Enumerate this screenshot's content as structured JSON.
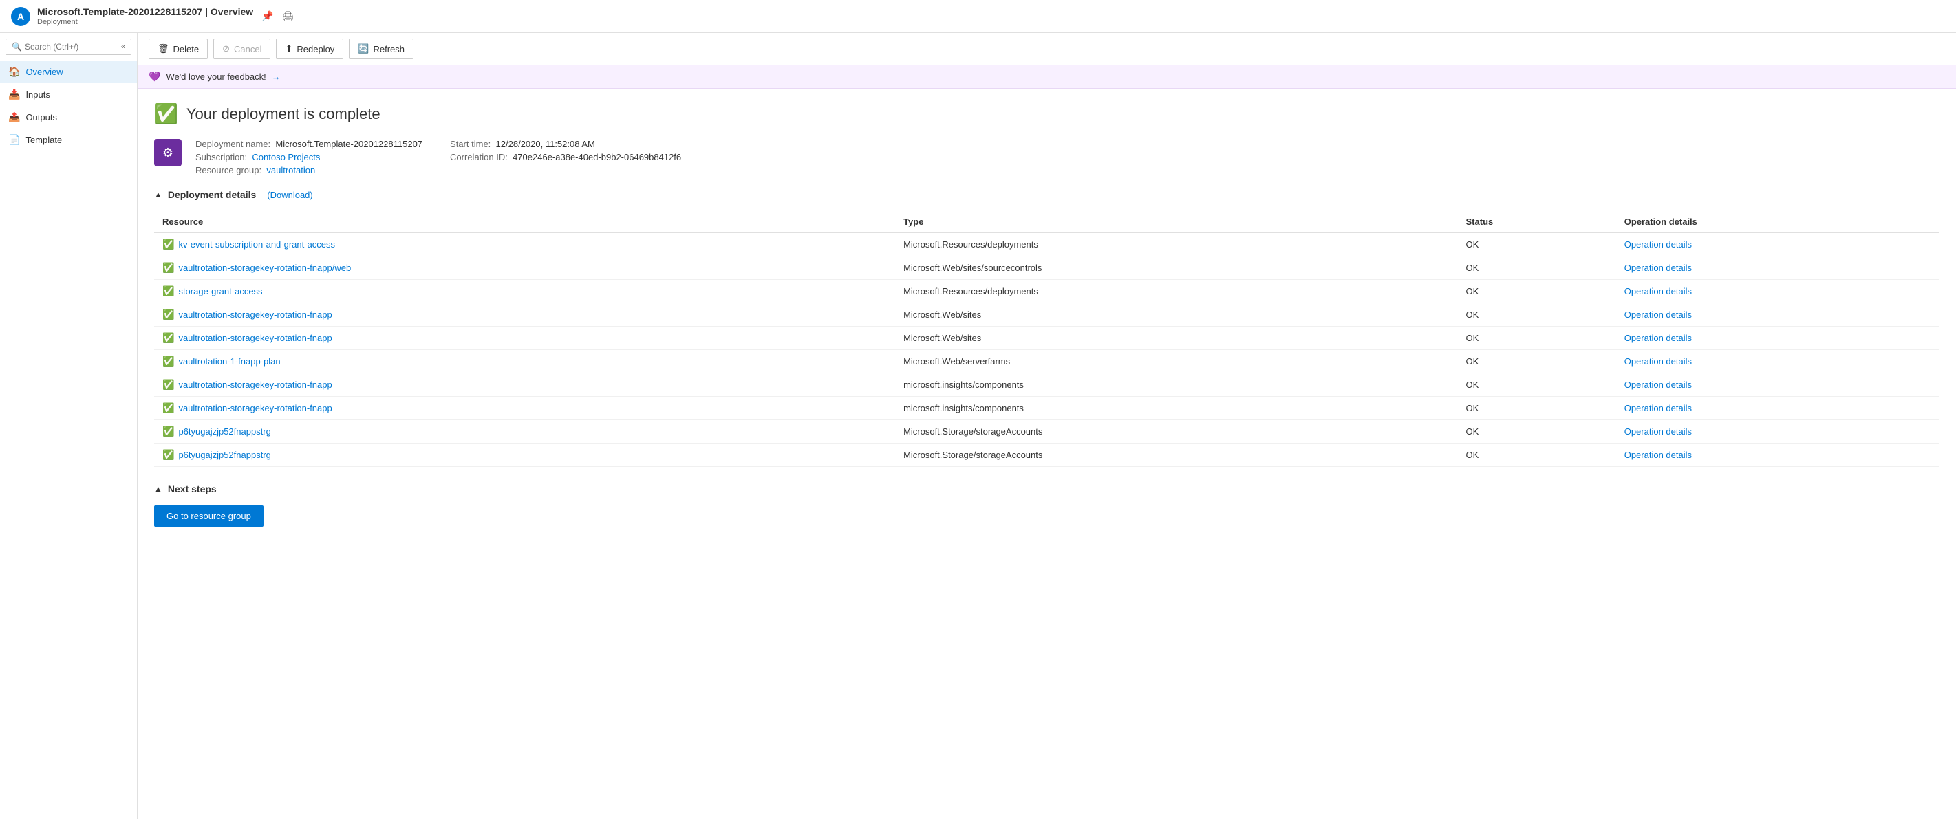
{
  "topbar": {
    "title": "Microsoft.Template-20201228115207 | Overview",
    "subtitle": "Deployment",
    "pin_icon": "📌",
    "print_icon": "🖨"
  },
  "sidebar": {
    "search_placeholder": "Search (Ctrl+/)",
    "collapse_icon": "«",
    "items": [
      {
        "id": "overview",
        "label": "Overview",
        "icon": "🏠",
        "active": true
      },
      {
        "id": "inputs",
        "label": "Inputs",
        "icon": "📥",
        "active": false
      },
      {
        "id": "outputs",
        "label": "Outputs",
        "icon": "📤",
        "active": false
      },
      {
        "id": "template",
        "label": "Template",
        "icon": "📄",
        "active": false
      }
    ]
  },
  "toolbar": {
    "delete_label": "Delete",
    "cancel_label": "Cancel",
    "redeploy_label": "Redeploy",
    "refresh_label": "Refresh"
  },
  "feedback": {
    "text": "We'd love your feedback!",
    "arrow": "→"
  },
  "deployment": {
    "complete_title": "Your deployment is complete",
    "name_label": "Deployment name:",
    "name_value": "Microsoft.Template-20201228115207",
    "subscription_label": "Subscription:",
    "subscription_value": "Contoso Projects",
    "resource_group_label": "Resource group:",
    "resource_group_value": "vaultrotation",
    "start_time_label": "Start time:",
    "start_time_value": "12/28/2020, 11:52:08 AM",
    "correlation_label": "Correlation ID:",
    "correlation_value": "470e246e-a38e-40ed-b9b2-06469b8412f6"
  },
  "details_section": {
    "title": "Deployment details",
    "download_label": "(Download)",
    "columns": {
      "resource": "Resource",
      "type": "Type",
      "status": "Status",
      "operation_details": "Operation details"
    },
    "rows": [
      {
        "resource": "kv-event-subscription-and-grant-access",
        "type": "Microsoft.Resources/deployments",
        "status": "OK",
        "operation": "Operation details"
      },
      {
        "resource": "vaultrotation-storagekey-rotation-fnapp/web",
        "type": "Microsoft.Web/sites/sourcecontrols",
        "status": "OK",
        "operation": "Operation details"
      },
      {
        "resource": "storage-grant-access",
        "type": "Microsoft.Resources/deployments",
        "status": "OK",
        "operation": "Operation details"
      },
      {
        "resource": "vaultrotation-storagekey-rotation-fnapp",
        "type": "Microsoft.Web/sites",
        "status": "OK",
        "operation": "Operation details"
      },
      {
        "resource": "vaultrotation-storagekey-rotation-fnapp",
        "type": "Microsoft.Web/sites",
        "status": "OK",
        "operation": "Operation details"
      },
      {
        "resource": "vaultrotation-1-fnapp-plan",
        "type": "Microsoft.Web/serverfarms",
        "status": "OK",
        "operation": "Operation details"
      },
      {
        "resource": "vaultrotation-storagekey-rotation-fnapp",
        "type": "microsoft.insights/components",
        "status": "OK",
        "operation": "Operation details"
      },
      {
        "resource": "vaultrotation-storagekey-rotation-fnapp",
        "type": "microsoft.insights/components",
        "status": "OK",
        "operation": "Operation details"
      },
      {
        "resource": "p6tyugajzjp52fnappstrg",
        "type": "Microsoft.Storage/storageAccounts",
        "status": "OK",
        "operation": "Operation details"
      },
      {
        "resource": "p6tyugajzjp52fnappstrg",
        "type": "Microsoft.Storage/storageAccounts",
        "status": "OK",
        "operation": "Operation details"
      }
    ]
  },
  "next_steps": {
    "title": "Next steps",
    "go_to_resource_group_label": "Go to resource group"
  }
}
